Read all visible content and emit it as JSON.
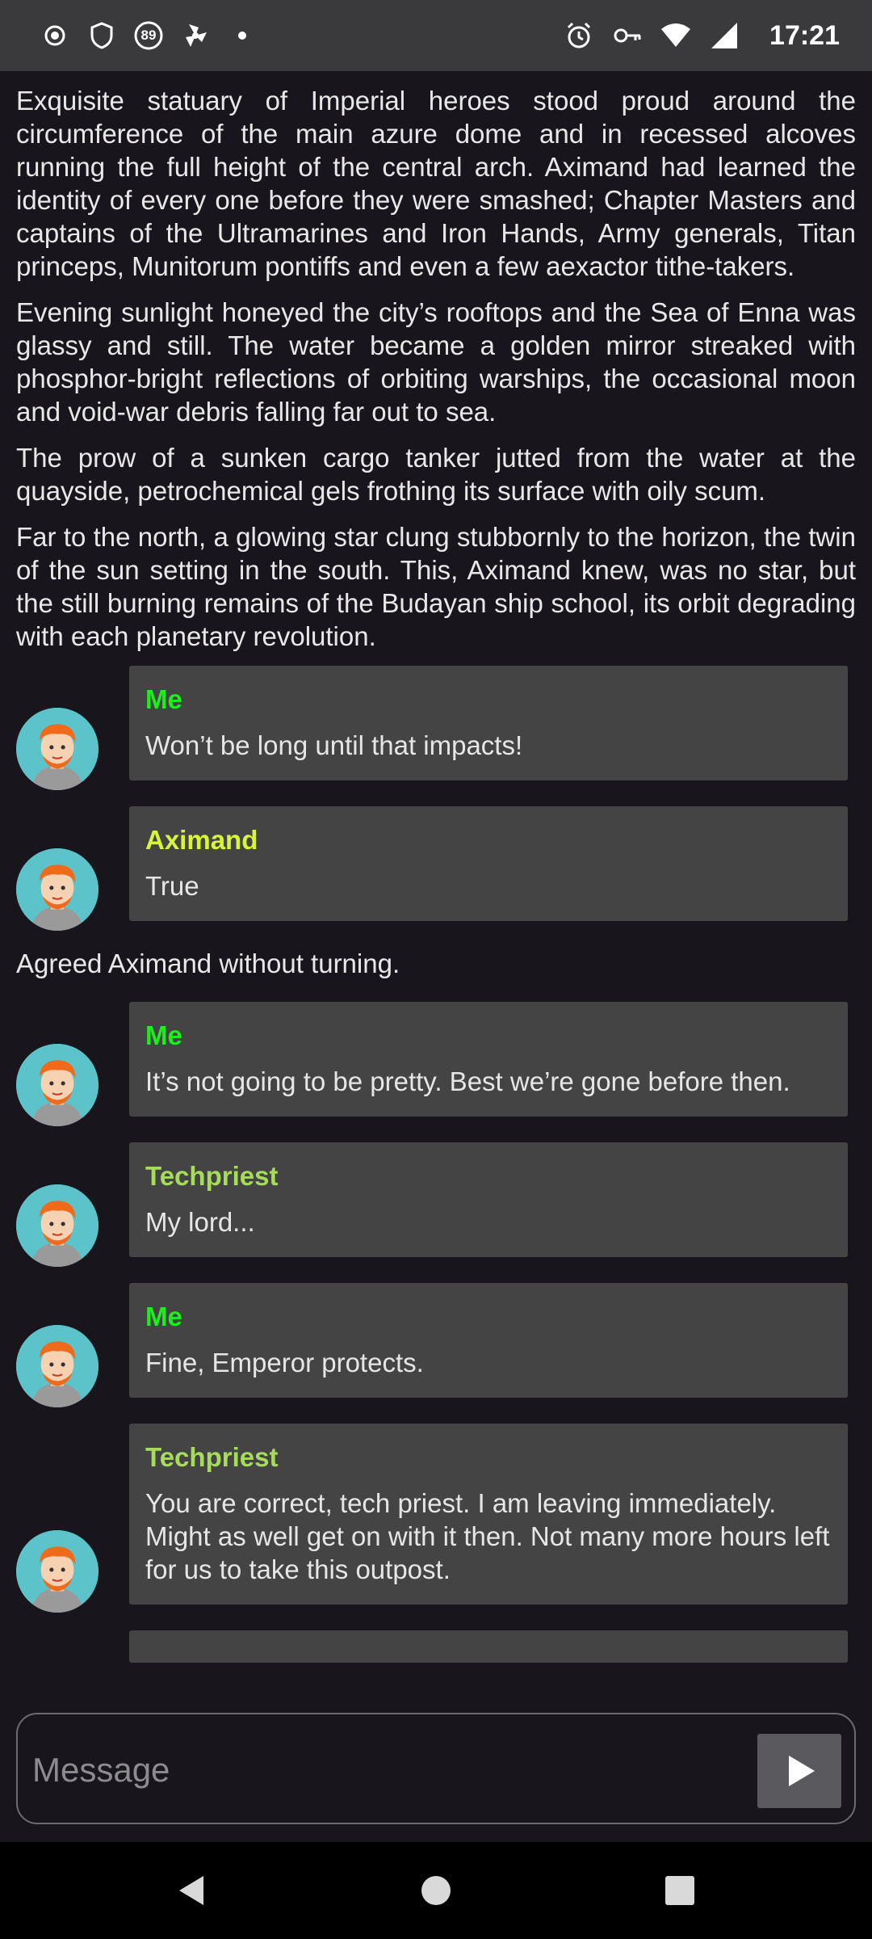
{
  "status_bar": {
    "time": "17:21",
    "badge": "89",
    "left_icons": [
      "record-icon",
      "shield-icon",
      "badge-icon",
      "fan-icon",
      "dot-icon"
    ],
    "right_icons": [
      "alarm-icon",
      "key-icon",
      "wifi-icon",
      "signal-icon"
    ]
  },
  "narration": [
    "Exquisite statuary of Imperial heroes stood proud around the circumference of the main azure dome and in recessed alcoves running the full height of the central arch. Aximand had learned the identity of every one before they were smashed; Chapter Masters and captains of the Ultramarines and Iron Hands, Army generals, Titan princeps, Munitorum pontiffs and even a few aexactor tithe-takers.",
    "Evening sunlight honeyed the city’s rooftops and the Sea of Enna was glassy and still. The water became a golden mirror streaked with phosphor-bright reflections of orbiting warships, the occasional moon and void-war debris falling far out to sea.",
    "The prow of a sunken cargo tanker jutted from the water at the quayside, petrochemical gels frothing its surface with oily scum.",
    "Far to the north, a glowing star clung stubbornly to the horizon, the twin of the sun setting in the south. This, Aximand knew, was no star, but the still burning remains of the Budayan ship school, its orbit degrading with each planetary revolution."
  ],
  "messages": [
    {
      "sender": "Me",
      "color": "#1cf01c",
      "text": "Won’t be long until that impacts!"
    },
    {
      "sender": "Aximand",
      "color": "#d8f53a",
      "text": "True"
    },
    {
      "sender": "Me",
      "color": "#1cf01c",
      "text": "It’s not going to be pretty. Best we’re gone before then."
    },
    {
      "sender": "Techpriest",
      "color": "#a6dc5a",
      "text": "My lord..."
    },
    {
      "sender": "Me",
      "color": "#1cf01c",
      "text": "Fine, Emperor protects."
    },
    {
      "sender": "Techpriest",
      "color": "#a6dc5a",
      "text": "You are correct, tech priest. I am leaving immediately. Might as well get on with it then. Not many more hours left for us to take this outpost."
    }
  ],
  "interjection": "Agreed Aximand without turning.",
  "composer": {
    "placeholder": "Message",
    "send_icon": "send-play-icon"
  },
  "nav_icons": [
    "back-icon",
    "home-icon",
    "recents-icon"
  ]
}
